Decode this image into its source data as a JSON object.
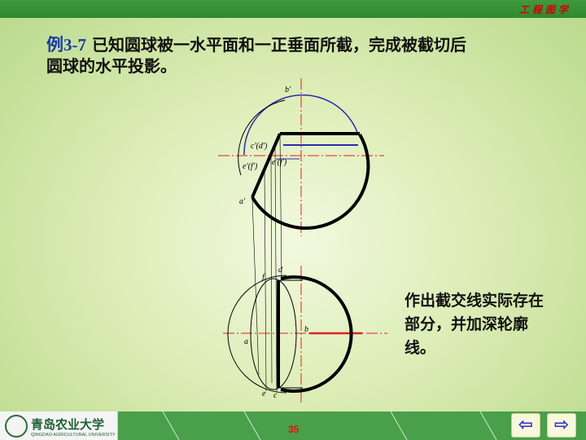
{
  "header": {
    "course_title": "工程图学"
  },
  "title": {
    "example_label": "例3-7",
    "line1": "已知圆球被一水平面和一正垂面所截，完成被截切后",
    "line2": "圆球的水平投影。"
  },
  "labels": {
    "b_prime": "b'",
    "cd_prime": "c'(d')",
    "ef_prime": "e'(f')",
    "ef_prime_2": "e'(f')",
    "a_prime": "a'",
    "f": "f",
    "d": "d",
    "b": "b",
    "a": "a",
    "e": "e",
    "c": "c"
  },
  "note": {
    "text": "作出截交线实际存在部分，并加深轮廓线。"
  },
  "footer": {
    "page_number": "35",
    "university_name": "青岛农业大学",
    "university_name_en": "QINGDAO AGRICULTURAL UNIVERSITY",
    "prev_icon": "arrow-left-icon",
    "next_icon": "arrow-right-icon",
    "prev_label": "⇦",
    "next_label": "⇨"
  },
  "colors": {
    "top_bar": "#2f8a2f",
    "accent_red": "#e02020",
    "drawing_blue": "#2a2ab0",
    "footer": "#4a9f4a"
  }
}
